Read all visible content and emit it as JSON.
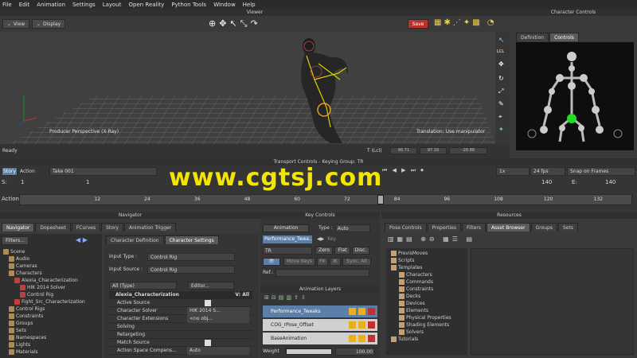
{
  "menu": [
    "File",
    "Edit",
    "Animation",
    "Settings",
    "Layout",
    "Open Reality",
    "Python Tools",
    "Window",
    "Help"
  ],
  "viewer": {
    "title": "Viewer",
    "view_btn": "View",
    "display_btn": "Display",
    "save_btn": "Save",
    "camera_label": "Producer Perspective (X-Ray)",
    "manip_label": "Translation: Use manipulator",
    "status": "Ready",
    "lcl": "T (Lcl)",
    "coords": [
      "86.71",
      "97.16",
      "-28.88"
    ]
  },
  "char_controls": {
    "title": "Character Controls",
    "tabs": [
      "Definition",
      "Controls"
    ],
    "active_tab": "Controls"
  },
  "transport": {
    "title": "Transport Controls  -  Keying Group: TR",
    "story": "Story",
    "action": "Action",
    "take": "Take 001",
    "speed": "1x",
    "fps": "24 fps",
    "snap": "Snap on Frames",
    "start_label": "S:",
    "start": "1",
    "end_label": "E:",
    "end": "140",
    "end2": "140",
    "current": "1",
    "action_label": "Action",
    "ticks": [
      "12",
      "24",
      "36",
      "48",
      "60",
      "72",
      "84",
      "96",
      "108",
      "120",
      "132"
    ],
    "playhead_fraction": 0.585
  },
  "watermark": "www.cgtsj.com",
  "navigator": {
    "title": "Navigator",
    "tabs": [
      "Navigator",
      "Dopesheet",
      "FCurves",
      "Story",
      "Animation Trigger"
    ],
    "filters": "Filters...",
    "tree": [
      {
        "indent": 0,
        "label": "Scene"
      },
      {
        "indent": 1,
        "label": "Audio"
      },
      {
        "indent": 1,
        "label": "Cameras"
      },
      {
        "indent": 1,
        "label": "Characters"
      },
      {
        "indent": 2,
        "label": "Alexia_Characterization"
      },
      {
        "indent": 3,
        "label": "HIK 2014 Solver"
      },
      {
        "indent": 3,
        "label": "Control Rig"
      },
      {
        "indent": 2,
        "label": "Fight_Src_Characterization"
      },
      {
        "indent": 1,
        "label": "Control Rigs"
      },
      {
        "indent": 1,
        "label": "Constraints"
      },
      {
        "indent": 1,
        "label": "Groups"
      },
      {
        "indent": 1,
        "label": "Sets"
      },
      {
        "indent": 1,
        "label": "Namespaces"
      },
      {
        "indent": 1,
        "label": "Lights"
      },
      {
        "indent": 1,
        "label": "Materials"
      }
    ],
    "char_tabs": [
      "Character Definition",
      "Character Settings"
    ],
    "input_type_label": "Input Type :",
    "input_type": "Control Rig",
    "input_source_label": "Input Source :",
    "input_source": "Control Rig",
    "all_type": "All (Type)",
    "editor_btn": "Editor...",
    "prop_header": "Alexia_Characterization",
    "prop_header_right": "V: All",
    "props": [
      {
        "label": "Active Source",
        "value": "check"
      },
      {
        "label": "Character Solver",
        "value": "HIK 2014 S..."
      },
      {
        "label": "Character Extensions",
        "value": "<no obj..."
      },
      {
        "label": "Solving",
        "value": ""
      },
      {
        "label": "Retargeting",
        "value": ""
      },
      {
        "label": "Match Source",
        "value": "check"
      },
      {
        "label": "Action Space Compens...",
        "value": "Auto"
      }
    ]
  },
  "key_controls": {
    "title": "Key Controls",
    "animation_btn": "Animation",
    "type_label": "Type :",
    "type_value": "Auto",
    "layer_value": "Performance_Twea...",
    "key_label": "Key",
    "tr": "TR",
    "zero": "Zero",
    "flat": "Flat",
    "disc": "Disc.",
    "move_keys": "Move Keys",
    "fk": "FK",
    "ik": "IK",
    "sync": "Sync. All",
    "ref": "Ref.:",
    "anim_layers_title": "Animation Layers",
    "layers": [
      "Performance_Tweaks",
      "COG_rPose_Offset",
      "BaseAnimation"
    ],
    "weight_label": "Weight",
    "weight": "100.00"
  },
  "resources": {
    "title": "Resources",
    "tabs": [
      "Pose Controls",
      "Properties",
      "Filters",
      "Asset Browser",
      "Groups",
      "Sets"
    ],
    "active_tab": "Asset Browser",
    "tree": [
      {
        "indent": 0,
        "label": "PrevisMoves"
      },
      {
        "indent": 0,
        "label": "Scripts"
      },
      {
        "indent": 0,
        "label": "Templates"
      },
      {
        "indent": 1,
        "label": "Characters"
      },
      {
        "indent": 1,
        "label": "Commands"
      },
      {
        "indent": 1,
        "label": "Constraints"
      },
      {
        "indent": 1,
        "label": "Decks"
      },
      {
        "indent": 1,
        "label": "Devices"
      },
      {
        "indent": 1,
        "label": "Elements"
      },
      {
        "indent": 1,
        "label": "Physical Properties"
      },
      {
        "indent": 1,
        "label": "Shading Elements"
      },
      {
        "indent": 1,
        "label": "Solvers"
      },
      {
        "indent": 0,
        "label": "Tutorials"
      }
    ]
  },
  "colors": {
    "accent_blue": "#5b7fa8",
    "watermark": "#f2e600",
    "save_red": "#c0302a",
    "rig_green": "#22dd22"
  }
}
